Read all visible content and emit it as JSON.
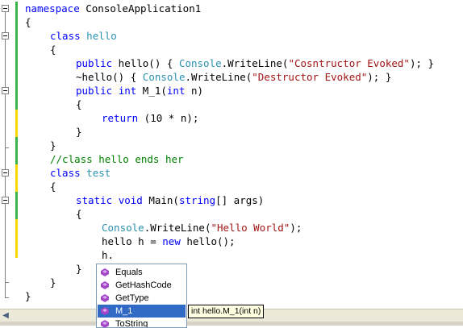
{
  "code": {
    "ns_kw": "namespace",
    "ns_name": " ConsoleApplication1",
    "brace": "{",
    "brace_close": "}",
    "class_kw": "class",
    "class_hello": " hello",
    "public_kw": "public",
    "ctor_name": " hello() { ",
    "console_type": "Console",
    "writeline": ".WriteLine(",
    "str_ctor": "\"Cosntructor Evoked\"",
    "call_end": "); }",
    "dtor_prefix": "~hello() { ",
    "str_dtor": "\"Destructor Evoked\"",
    "int_kw": "int",
    "m1_name": " M_1(",
    "param_n": " n)",
    "return_kw": "return",
    "return_expr": " (10 * n);",
    "comment": "//class hello ends her",
    "class_test": " test",
    "static_kw": "static",
    "void_kw": "void",
    "main_name": " Main(",
    "string_kw": "string",
    "args": "[] args)",
    "str_hello": "\"Hello World\"",
    "stmt_end": ");",
    "hello_h": "hello h = ",
    "new_kw": "new",
    "hello_call": " hello();",
    "h_dot": "h."
  },
  "intellisense": {
    "items": [
      {
        "label": "Equals",
        "selected": false
      },
      {
        "label": "GetHashCode",
        "selected": false
      },
      {
        "label": "GetType",
        "selected": false
      },
      {
        "label": "M_1",
        "selected": true
      },
      {
        "label": "ToString",
        "selected": false
      }
    ],
    "tooltip": "int hello.M_1(int n)"
  },
  "colors": {
    "keyword": "#0000ff",
    "type": "#2b91af",
    "string": "#a31515",
    "comment": "#008000",
    "gutter_saved": "#3cb34a",
    "gutter_changed": "#ffd700",
    "selection": "#316ac5",
    "method_icon": "#a347c9"
  },
  "icons": {
    "fold_toggle": "minus-box-icon",
    "member": "method-icon",
    "scroll_left": "scroll-left-arrow-icon"
  }
}
